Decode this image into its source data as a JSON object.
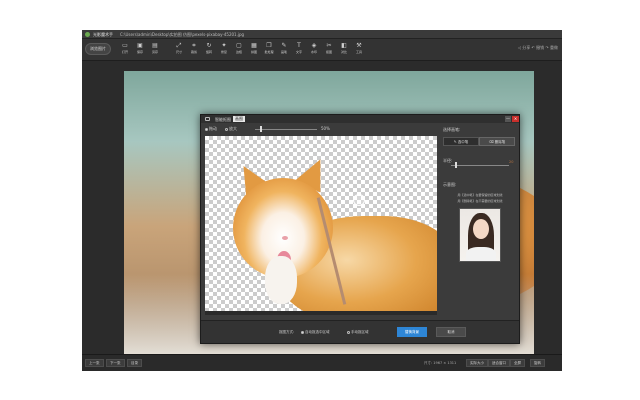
{
  "app": {
    "title": "光影魔术手",
    "path": "C:\\Users\\admin\\Desktop\\实拍图 仿图\\pexels-pixabay-45201.jpg"
  },
  "toolbar": {
    "open_label": "浏览图片",
    "items": [
      {
        "icon": "open-icon",
        "label": "打开"
      },
      {
        "icon": "save-icon",
        "label": "保存"
      },
      {
        "icon": "saveas-icon",
        "label": "另存"
      },
      {
        "icon": "size-icon",
        "label": "尺寸"
      },
      {
        "icon": "crop-icon",
        "label": "裁剪"
      },
      {
        "icon": "rotate-icon",
        "label": "旋转"
      },
      {
        "icon": "retouch-icon",
        "label": "修复"
      },
      {
        "icon": "frame-icon",
        "label": "边框"
      },
      {
        "icon": "collage-icon",
        "label": "拼图"
      },
      {
        "icon": "batch-icon",
        "label": "批处理"
      },
      {
        "icon": "brush-icon",
        "label": "画笔"
      },
      {
        "icon": "text-icon",
        "label": "文字"
      },
      {
        "icon": "watermark-icon",
        "label": "水印"
      },
      {
        "icon": "cutout-icon",
        "label": "抠图"
      },
      {
        "icon": "compare-icon",
        "label": "对比"
      },
      {
        "icon": "tools-icon",
        "label": "工具"
      }
    ],
    "view_controls": "◁ 分享   ↶ 撤销   ↷ 重做"
  },
  "dialog": {
    "title": "智能抠图",
    "tab": "画图",
    "opt_pan": "拖动",
    "opt_zoom": "放大",
    "zoom_value": "50%",
    "zoom_fraction": 0.08,
    "min_label": "—",
    "close_label": "×",
    "panel": {
      "select_label": "选择画笔:",
      "mode_keep": "选中笔",
      "mode_erase": "删除笔",
      "brush_label": "半径:",
      "brush_value": "20",
      "brush_fraction": 0.07,
      "example_label": "示意图:",
      "hint1": "用【选中笔】在要保留的区域划线",
      "hint2": "用【删除笔】在不需要的区域划线"
    },
    "footer": {
      "mode_label": "抠图方式:",
      "radio1": "自动抠选中区域",
      "radio2": "手动抠区域",
      "save_label": "替换背景",
      "cancel_label": "取消"
    }
  },
  "statusbar": {
    "prev": "上一张",
    "next": "下一张",
    "list": "目录",
    "info": "尺寸: 1967 × 1311",
    "actions": [
      "实际大小",
      "适合窗口",
      "全屏",
      "旋转"
    ]
  }
}
